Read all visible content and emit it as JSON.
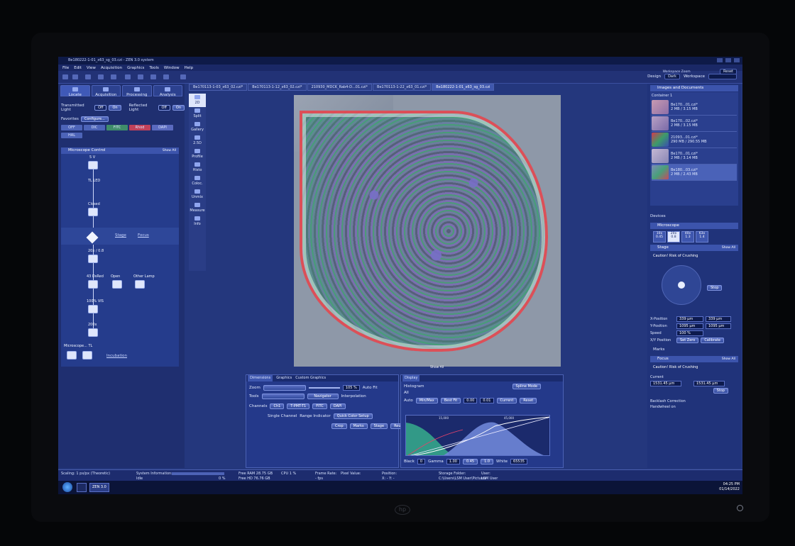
{
  "window": {
    "title": "Be180222-1-01_x63_sg_03.czi - ZEN 3.0 system",
    "workspace_zoom_label": "Workspace Zoom",
    "reset_label": "Reset"
  },
  "menu": [
    "File",
    "Edit",
    "View",
    "Acquisition",
    "Graphics",
    "Tools",
    "Window",
    "Help"
  ],
  "toolbar": {
    "design_label": "Design",
    "design_value": "Dark",
    "workspace_label": "Workspace"
  },
  "left": {
    "tabs": [
      "Locate",
      "Acquisition",
      "Processing",
      "Analysis"
    ],
    "transmitted_label": "Transmitted Light",
    "reflected_label": "Reflected Light",
    "off": "Off",
    "on": "On",
    "favorites_label": "Favorites",
    "configure_label": "Configure...",
    "channels": [
      "OFF",
      "DIC",
      "FITC",
      "Rhod",
      "DAPI"
    ],
    "hal_label": "HAL",
    "mc_title": "Microscope Control",
    "show_all": "Show All",
    "nodes": {
      "n1": "5 V",
      "n2": "TL LED",
      "n3": "Closed",
      "n4": "20x / 0.8",
      "n5": "43 DsRed",
      "n6": "Open",
      "n7": "Other Lamp",
      "n8": "100% VIS",
      "n9": "200x"
    },
    "stage_link": "Stage",
    "focus_link": "Focus",
    "bottom_label": "Microscope... TL",
    "incubation_link": "Incubation"
  },
  "center": {
    "doc_tabs": [
      "Be170113-1-03_x63_02.czi*",
      "Be170113-1-12_x63_02.czi*",
      "210930_MDCK_Rab4-D...01.czi*",
      "Be170113-1-22_x63_01.czi*",
      "Be180222-1-01_x63_sg_03.czi"
    ],
    "view_tabs": [
      "2D",
      "Split",
      "Gallery",
      "2.5D",
      "Profile",
      "Histo",
      "Coloc.",
      "Unmix",
      "Measure",
      "Info"
    ],
    "show_all": "Show All"
  },
  "dims": {
    "tabs": [
      "Dimensions",
      "Graphics",
      "Custom Graphics"
    ],
    "zoom_label": "Zoom",
    "zoom_value": "105 %",
    "autofit_label": "Auto Fit",
    "tools_label": "Tools",
    "navigator_label": "Navigator",
    "interpolation_label": "Interpolation",
    "channels_label": "Channels",
    "ch_buttons": [
      "Ch1",
      "T-PMT-T1",
      "FITC",
      "DAPI"
    ],
    "single_channel_label": "Single Channel",
    "range_indicator_label": "Range Indicator",
    "quick_color_label": "Quick Color Setup",
    "bottom_buttons": [
      "Crop",
      "Marks",
      "Stage",
      "Reuse"
    ]
  },
  "display": {
    "tab": "Display",
    "histogram_label": "Histogram",
    "spline_label": "Spline Mode",
    "all_label": "All",
    "auto_label": "Auto",
    "minmax_label": "Min/Max",
    "bestfit_label": "Best Fit",
    "bestfit_val1": "0.00",
    "bestfit_val2": "0.01",
    "current_label": "Current",
    "reset_label": "Reset",
    "tick1": "15,000",
    "tick2": "45,000",
    "black_label": "Black",
    "black_value": "0",
    "gamma_label": "Gamma",
    "gamma_value": "1.00",
    "gamma_b1": "0.45",
    "gamma_b2": "1.0",
    "white_label": "White",
    "white_value": "65535"
  },
  "right": {
    "images_title": "Images and Documents",
    "container_label": "Container 1",
    "thumbs": [
      {
        "name": "Be170...01.czi*",
        "size": "2 MB / 3.15 MB"
      },
      {
        "name": "Be170...02.czi*",
        "size": "2 MB / 3.15 MB"
      },
      {
        "name": "21093...01.czi*",
        "size": "290 MB / 290.55 MB"
      },
      {
        "name": "Be170...01.czi*",
        "size": "2 MB / 3.14 MB"
      },
      {
        "name": "Be180...03.czi*",
        "size": "2 MB / 2.43 MB"
      }
    ],
    "devices_label": "Devices",
    "microscope_label": "Microscope",
    "objectives": [
      {
        "mag": "10x",
        "na": "0.45"
      },
      {
        "mag": "20x",
        "na": "0.8"
      },
      {
        "mag": "40x",
        "na": "1.3"
      },
      {
        "mag": "63x",
        "na": "1.4"
      }
    ],
    "stage_title": "Stage",
    "show_all": "Show All",
    "caution": "Caution! Risk of Crushing",
    "stop_label": "Stop",
    "xpos_label": "X-Position",
    "xpos_value": "339 µm",
    "xpos_value2": "339 µm",
    "ypos_label": "Y-Position",
    "ypos_value": "1095 µm",
    "ypos_value2": "1095 µm",
    "speed_label": "Speed",
    "speed_value": "100 %",
    "xypos_label": "X/Y Position",
    "setzero_label": "Set Zero",
    "calibrate_label": "Calibrate",
    "marks_label": "Marks",
    "focus_title": "Focus",
    "current_label": "Current",
    "current_value": "1531.45 µm",
    "current_value2": "1531.45 µm",
    "backlash_label": "Backlash Correction",
    "handwheel_label": "Handwheel on"
  },
  "status": {
    "scaling": "Scaling: 1 px/px (Theoretic)",
    "sysinfo_label": "System Information:",
    "sysinfo_value": "Idle",
    "percent": "0 %",
    "ram": "Free RAM 28.75 GB",
    "hd": "Free HD 76.76 GB",
    "cpu": "CPU 1 %",
    "frame_rate": "Frame Rate:",
    "fps": "- fps",
    "pixel_value": "Pixel Value:",
    "position": "Position:",
    "position_value": "X: -  Y: -",
    "storage_label": "Storage Folder:",
    "storage_value": "C:\\Users\\LSM User\\Pictures",
    "user_label": "User:",
    "user_value": "LSM User"
  },
  "taskbar": {
    "app_label": "ZEN 3.0",
    "time": "04:25 PM",
    "date": "01/14/2022"
  }
}
